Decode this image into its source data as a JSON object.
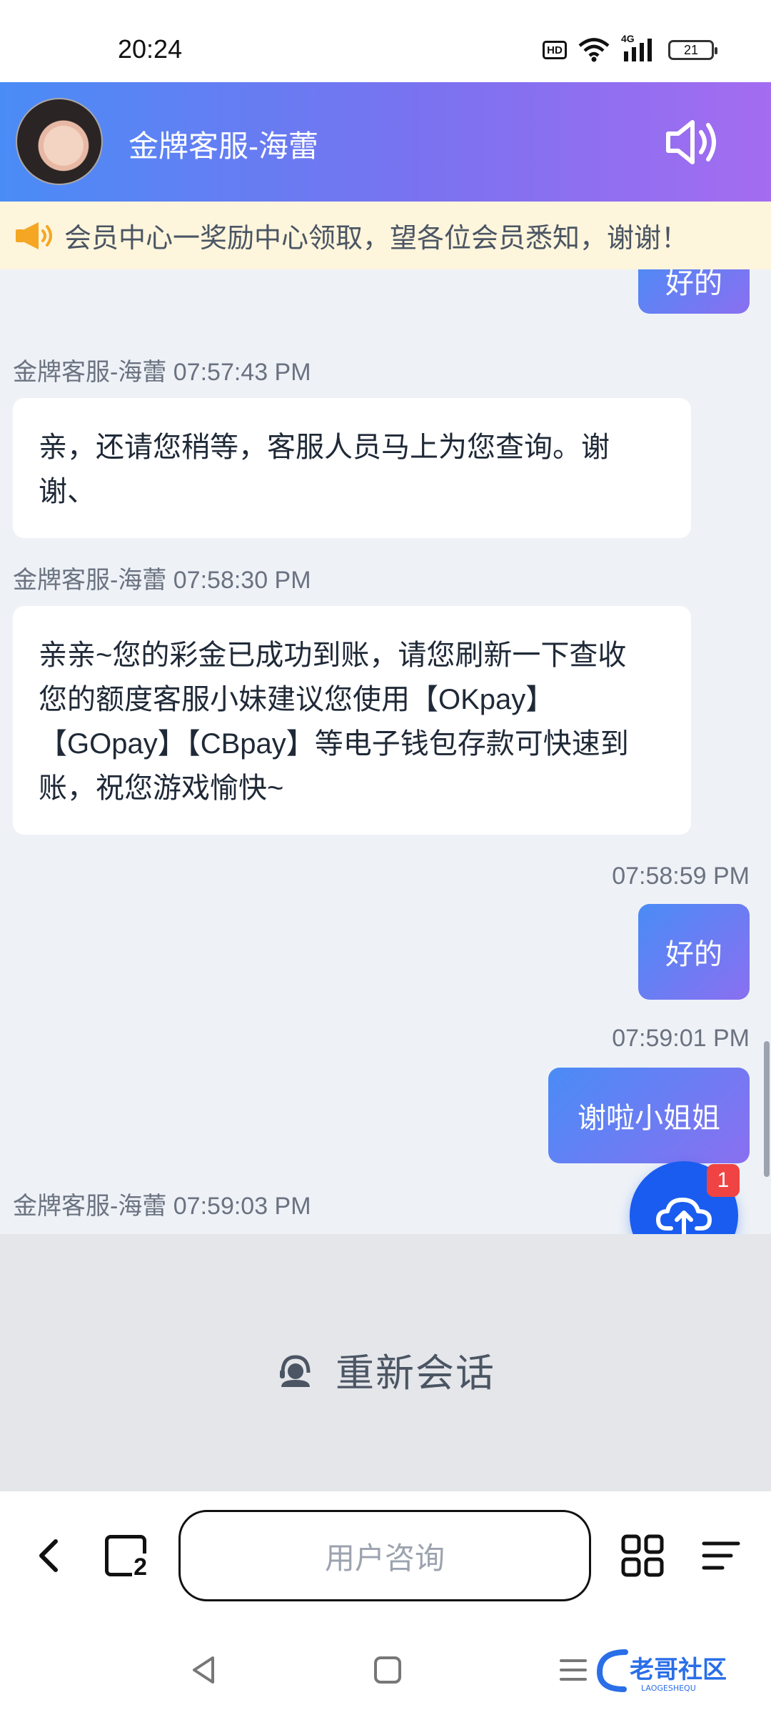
{
  "status_bar": {
    "time": "20:24",
    "hd": "HD",
    "battery": "21",
    "network": "4G"
  },
  "header": {
    "title": "金牌客服-海蕾"
  },
  "notice": {
    "text": "会员中心一奖励中心领取，望各位会员悉知，谢谢！"
  },
  "messages": [
    {
      "type": "out",
      "text": "好的"
    },
    {
      "type": "in",
      "meta": "金牌客服-海蕾 07:57:43 PM",
      "lines": [
        "亲，还请您稍等，客服人员马上为您查询。谢",
        "谢、"
      ]
    },
    {
      "type": "in",
      "meta": "金牌客服-海蕾 07:58:30 PM",
      "lines": [
        "亲亲~您的彩金已成功到账，请您刷新一下查收",
        "您的额度客服小妹建议您使用【OKpay】",
        "【GOpay】【CBpay】等电子钱包存款可快速到",
        "账，祝您游戏愉快~"
      ]
    },
    {
      "type": "out",
      "meta": "07:58:59 PM",
      "text": "好的"
    },
    {
      "type": "out",
      "meta": "07:59:01 PM",
      "text": "谢啦小姐姐"
    },
    {
      "type": "in",
      "meta": "金牌客服-海蕾 07:59:03 PM"
    }
  ],
  "fab": {
    "badge": "1"
  },
  "restart": {
    "label": "重新会话"
  },
  "browser": {
    "address_placeholder": "用户咨询",
    "tabs_count": "2"
  },
  "watermark": {
    "text": "老哥社区",
    "subtext": "LAOGESHEQU"
  }
}
